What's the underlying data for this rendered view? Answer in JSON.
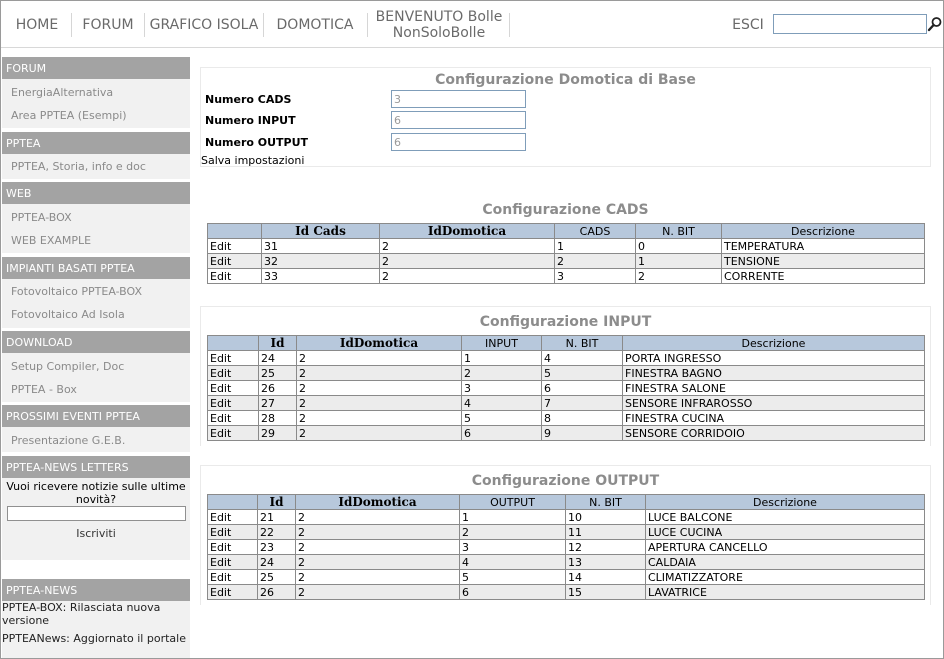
{
  "nav": {
    "home": "HOME",
    "forum": "FORUM",
    "grafico": "GRAFICO ISOLA",
    "domotica": "DOMOTICA",
    "welcome_line1": "BENVENUTO Bolle",
    "welcome_line2": "NonSoloBolle",
    "logout": "ESCI",
    "search_value": ""
  },
  "sidebar": {
    "forum_header": "FORUM",
    "forum_items": [
      "EnergiaAlternativa",
      "Area PPTEA (Esempi)"
    ],
    "pptea_header": "PPTEA",
    "pptea_items": [
      "PPTEA, Storia, info e doc"
    ],
    "web_header": "WEB",
    "web_items": [
      "PPTEA-BOX",
      "WEB EXAMPLE"
    ],
    "impianti_header": "IMPIANTI BASATI PPTEA",
    "impianti_items": [
      "Fotovoltaico PPTEA-BOX",
      "Fotovoltaico Ad Isola"
    ],
    "download_header": "DOWNLOAD",
    "download_items": [
      "Setup Compiler, Doc",
      "PPTEA - Box"
    ],
    "eventi_header": "PROSSIMI EVENTI PPTEA",
    "eventi_items": [
      "Presentazione G.E.B."
    ],
    "newsletter_header": "PPTEA-NEWS LETTERS",
    "newsletter_text": "Vuoi ricevere notizie sulle ultime novità?",
    "newsletter_button": "Iscriviti",
    "news_header": "PPTEA-NEWS",
    "news_items": [
      "PPTEA-BOX: Rilasciata nuova versione",
      "PPTEANews: Aggiornato il portale"
    ]
  },
  "config": {
    "title": "Configurazione Domotica di Base",
    "cads_label": "Numero CADS",
    "cads_value": "3",
    "input_label": "Numero INPUT",
    "input_value": "6",
    "output_label": "Numero OUTPUT",
    "output_value": "6",
    "save": "Salva impostazioni"
  },
  "cads": {
    "title": "Configurazione CADS",
    "headers": [
      "",
      "Id Cads",
      "IdDomotica",
      "CADS",
      "N. BIT",
      "Descrizione"
    ],
    "rows": [
      [
        "Edit",
        "31",
        "2",
        "1",
        "0",
        "TEMPERATURA"
      ],
      [
        "Edit",
        "32",
        "2",
        "2",
        "1",
        "TENSIONE"
      ],
      [
        "Edit",
        "33",
        "2",
        "3",
        "2",
        "CORRENTE"
      ]
    ]
  },
  "input": {
    "title": "Configurazione INPUT",
    "headers": [
      "",
      "Id",
      "IdDomotica",
      "INPUT",
      "N. BIT",
      "Descrizione"
    ],
    "rows": [
      [
        "Edit",
        "24",
        "2",
        "1",
        "4",
        "PORTA INGRESSO"
      ],
      [
        "Edit",
        "25",
        "2",
        "2",
        "5",
        "FINESTRA BAGNO"
      ],
      [
        "Edit",
        "26",
        "2",
        "3",
        "6",
        "FINESTRA SALONE"
      ],
      [
        "Edit",
        "27",
        "2",
        "4",
        "7",
        "SENSORE INFRAROSSO"
      ],
      [
        "Edit",
        "28",
        "2",
        "5",
        "8",
        "FINESTRA CUCINA"
      ],
      [
        "Edit",
        "29",
        "2",
        "6",
        "9",
        "SENSORE CORRIDOIO"
      ]
    ]
  },
  "output": {
    "title": "Configurazione OUTPUT",
    "headers": [
      "",
      "Id",
      "IdDomotica",
      "OUTPUT",
      "N. BIT",
      "Descrizione"
    ],
    "rows": [
      [
        "Edit",
        "21",
        "2",
        "1",
        "10",
        "LUCE BALCONE"
      ],
      [
        "Edit",
        "22",
        "2",
        "2",
        "11",
        "LUCE CUCINA"
      ],
      [
        "Edit",
        "23",
        "2",
        "3",
        "12",
        "APERTURA CANCELLO"
      ],
      [
        "Edit",
        "24",
        "2",
        "4",
        "13",
        "CALDAIA"
      ],
      [
        "Edit",
        "25",
        "2",
        "5",
        "14",
        "CLIMATIZZATORE"
      ],
      [
        "Edit",
        "26",
        "2",
        "6",
        "15",
        "LAVATRICE"
      ]
    ]
  }
}
